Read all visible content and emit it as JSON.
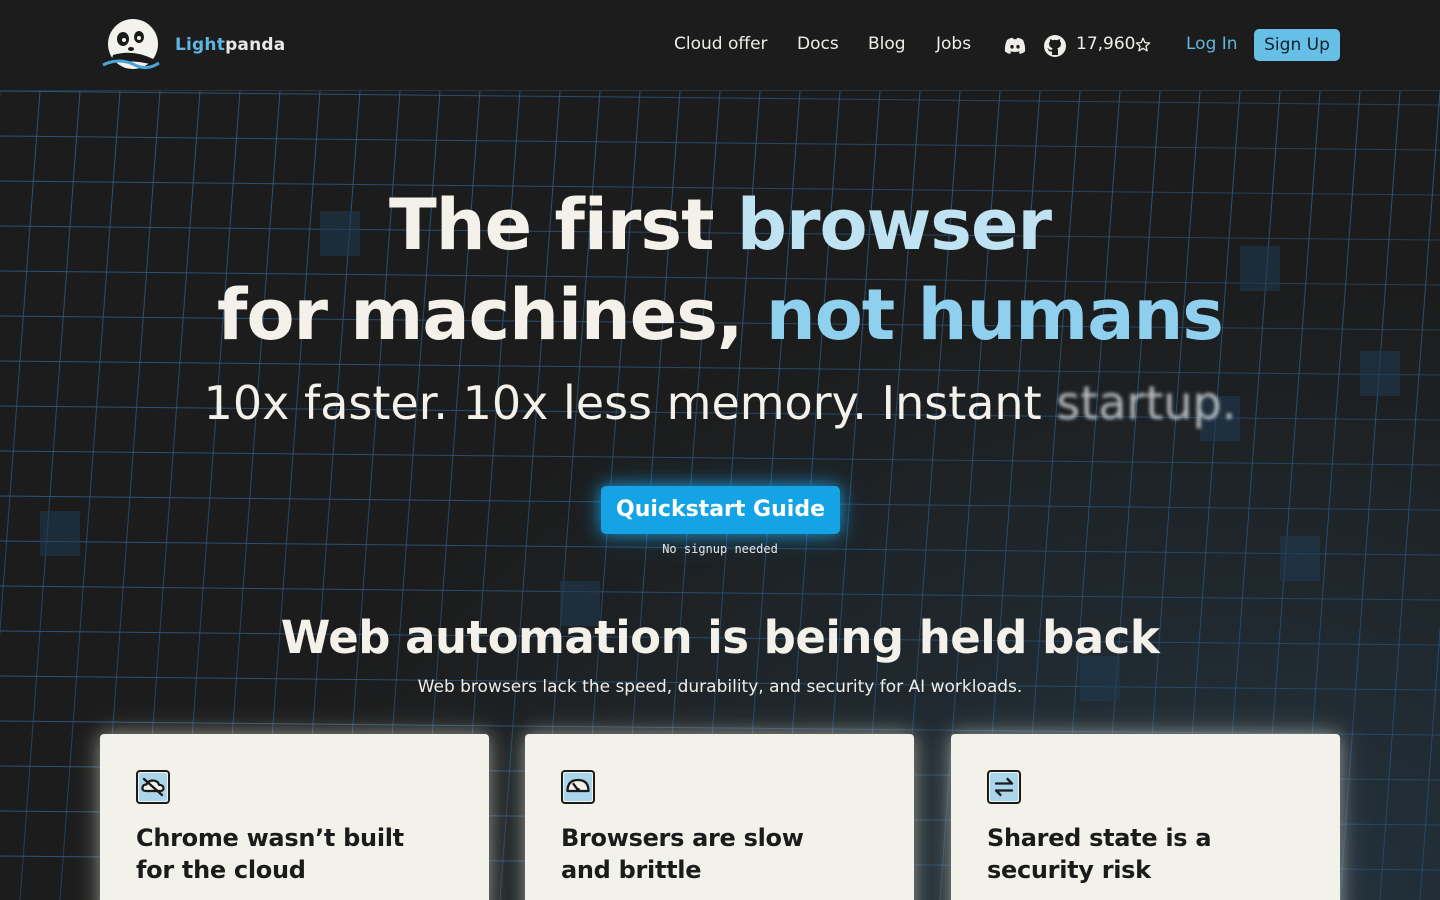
{
  "nav": {
    "brand_light": "Light",
    "brand_panda": "panda",
    "links": [
      "Cloud offer",
      "Docs",
      "Blog",
      "Jobs"
    ],
    "github_stars": "17,960",
    "login": "Log In",
    "signup": "Sign Up",
    "icons": [
      "panda-logo-icon",
      "discord-icon",
      "github-icon",
      "star-icon"
    ]
  },
  "hero": {
    "title_line1_white": "The first ",
    "title_line1_blue": "browser",
    "title_line2_white": "for machines, ",
    "title_line2_blue": "not humans",
    "subtitle_main": "10x faster. 10x less memory. Instant ",
    "subtitle_blur": "startup.",
    "cta_label": "Quickstart Guide",
    "cta_note": "No signup needed"
  },
  "section": {
    "title": "Web automation is being held back",
    "subtitle": "Web browsers lack the speed, durability, and security for AI workloads."
  },
  "cards": [
    {
      "title": "Chrome wasn’t built for the cloud",
      "icon": "cloud-off-icon"
    },
    {
      "title": "Browsers are slow and brittle",
      "icon": "gauge-icon"
    },
    {
      "title": "Shared state is a security risk",
      "icon": "swap-arrows-icon"
    }
  ],
  "colors": {
    "background": "#1c1c1c",
    "accent": "#5fb6e0",
    "cta": "#14a3e4",
    "card": "#f3f2ea"
  }
}
